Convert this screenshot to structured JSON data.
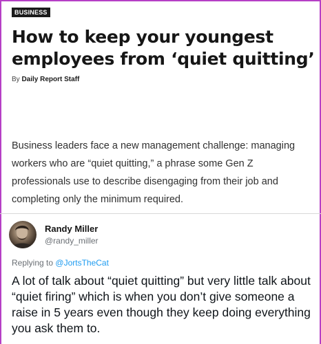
{
  "article": {
    "category": "BUSINESS",
    "headline": "How to keep your youngest employees from ‘quiet quitting’",
    "byline_prefix": "By",
    "author": "Daily Report Staff",
    "summary": "Business leaders face a new management challenge: managing workers who are “quiet quitting,” a phrase some Gen Z professionals use to describe disengaging from their job and completing only the minimum required."
  },
  "tweet": {
    "display_name": "Randy Miller",
    "handle": "@randy_miller",
    "replying_prefix": "Replying to",
    "replying_to": "@JortsTheCat",
    "text": "A lot of talk about “quiet quitting” but very little talk about “quiet firing” which is when you don’t give someone a raise in 5 years even though they keep doing everything you ask them to."
  },
  "colors": {
    "frame": "#b63fc6",
    "mention": "#1d9bf0",
    "category_bg": "#1b1b1b"
  }
}
